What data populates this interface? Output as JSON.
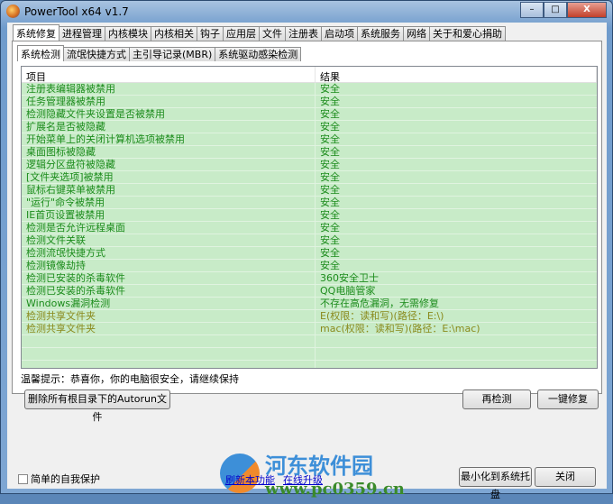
{
  "window": {
    "title": "PowerTool x64 v1.7",
    "min": "–",
    "max": "□",
    "close": "X"
  },
  "tabs": [
    "系统修复",
    "进程管理",
    "内核模块",
    "内核相关",
    "钩子",
    "应用层",
    "文件",
    "注册表",
    "启动项",
    "系统服务",
    "网络",
    "关于和爱心捐助"
  ],
  "subtabs": [
    "系统检测",
    "流氓快捷方式",
    "主引导记录(MBR)",
    "系统驱动感染检测"
  ],
  "list": {
    "headers": [
      "项目",
      "结果"
    ],
    "rows": [
      {
        "item": "注册表编辑器被禁用",
        "result": "安全"
      },
      {
        "item": "任务管理器被禁用",
        "result": "安全"
      },
      {
        "item": "检测隐藏文件夹设置是否被禁用",
        "result": "安全"
      },
      {
        "item": "扩展名是否被隐藏",
        "result": "安全"
      },
      {
        "item": "开始菜单上的关闭计算机选项被禁用",
        "result": "安全"
      },
      {
        "item": "桌面图标被隐藏",
        "result": "安全"
      },
      {
        "item": "逻辑分区盘符被隐藏",
        "result": "安全"
      },
      {
        "item": "[文件夹选项]被禁用",
        "result": "安全"
      },
      {
        "item": "鼠标右键菜单被禁用",
        "result": "安全"
      },
      {
        "item": "\"运行\"命令被禁用",
        "result": "安全"
      },
      {
        "item": "IE首页设置被禁用",
        "result": "安全"
      },
      {
        "item": "检测是否允许远程桌面",
        "result": "安全"
      },
      {
        "item": "检测文件关联",
        "result": "安全"
      },
      {
        "item": "检测流氓快捷方式",
        "result": "安全"
      },
      {
        "item": "检测镜像劫持",
        "result": "安全"
      },
      {
        "item": "检测已安装的杀毒软件",
        "result": "360安全卫士"
      },
      {
        "item": "检测已安装的杀毒软件",
        "result": "QQ电脑管家"
      },
      {
        "item": "Windows漏洞检测",
        "result": "不存在高危漏洞，无需修复"
      },
      {
        "item": "检测共享文件夹",
        "result": "E(权限：读和写)(路径：E:\\)",
        "warn": true
      },
      {
        "item": "检测共享文件夹",
        "result": "mac(权限：读和写)(路径：E:\\mac)",
        "warn": true
      }
    ]
  },
  "status": "温馨提示：恭喜你，你的电脑很安全，请继续保持",
  "buttons": {
    "delete_autorun": "删除所有根目录下的Autorun文件",
    "recheck": "再检测",
    "fix": "一键修复",
    "minimize_tray": "最小化到系统托盘",
    "close": "关闭"
  },
  "self_protect": "简单的自我保护",
  "links": {
    "refresh": "刷新本功能",
    "upgrade": "在线升级"
  },
  "watermark": {
    "name": "河东软件园",
    "url": "www.pc0359.cn"
  }
}
